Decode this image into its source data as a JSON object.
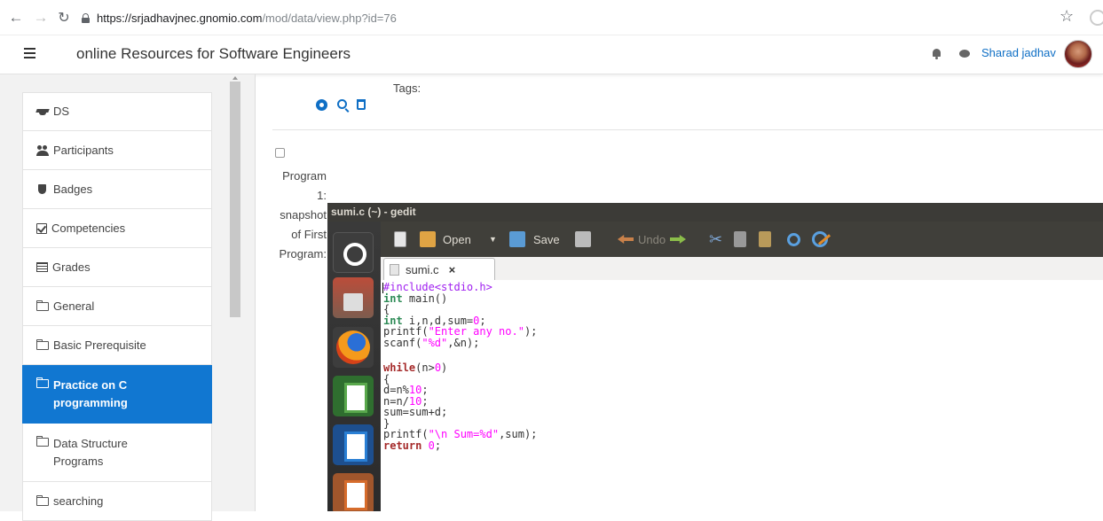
{
  "browser": {
    "url_host": "https://srjadhavjnec.gnomio.com",
    "url_path": "/mod/data/view.php?id=76"
  },
  "header": {
    "site_title": "online Resources for Software Engineers",
    "user_name": "Sharad jadhav"
  },
  "sidebar": {
    "items": [
      {
        "label": "DS",
        "icon": "graduation-cap-icon"
      },
      {
        "label": "Participants",
        "icon": "users-icon"
      },
      {
        "label": "Badges",
        "icon": "badge-icon"
      },
      {
        "label": "Competencies",
        "icon": "check-square-icon"
      },
      {
        "label": "Grades",
        "icon": "table-icon"
      },
      {
        "label": "General",
        "icon": "folder-icon"
      },
      {
        "label": "Basic Prerequisite",
        "icon": "folder-icon"
      },
      {
        "label": "Practice on C programming",
        "icon": "folder-icon",
        "active": true
      },
      {
        "label": "Data Structure Programs",
        "icon": "folder-icon"
      },
      {
        "label": "searching",
        "icon": "folder-icon"
      }
    ]
  },
  "main": {
    "tags_label": "Tags:",
    "field_label_lines": [
      "Program",
      "1:",
      "snapshot",
      "of First",
      "Program:"
    ]
  },
  "gedit": {
    "window_title": "sumi.c (~) - gedit",
    "toolbar": {
      "open_label": "Open",
      "save_label": "Save",
      "undo_label": "Undo"
    },
    "tab_label": "sumi.c",
    "tab_close": "×"
  },
  "code": {
    "l1": "#include<stdio.h>",
    "l2_kw": "int",
    "l2_rest": " main()",
    "l3": "{",
    "l4_kw": "int",
    "l4_rest": " i,n,d,sum=",
    "l4_num": "0",
    "l4_end": ";",
    "l5_a": "printf(",
    "l5_str": "\"Enter any no.\"",
    "l5_b": ");",
    "l6_a": "scanf(",
    "l6_str": "\"%d\"",
    "l6_b": ",&n);",
    "l7_kw": "while",
    "l7_a": "(n>",
    "l7_num": "0",
    "l7_b": ")",
    "l8": "{",
    "l9_a": "d=n%",
    "l9_num": "10",
    "l9_b": ";",
    "l10_a": "n=n/",
    "l10_num": "10",
    "l10_b": ";",
    "l11": "sum=sum+d;",
    "l12": "}",
    "l13_a": "printf(",
    "l13_str": "\"\\n Sum=%d\"",
    "l13_b": ",sum);",
    "l14_kw": "return",
    "l14_sp": " ",
    "l14_num": "0",
    "l14_b": ";"
  }
}
